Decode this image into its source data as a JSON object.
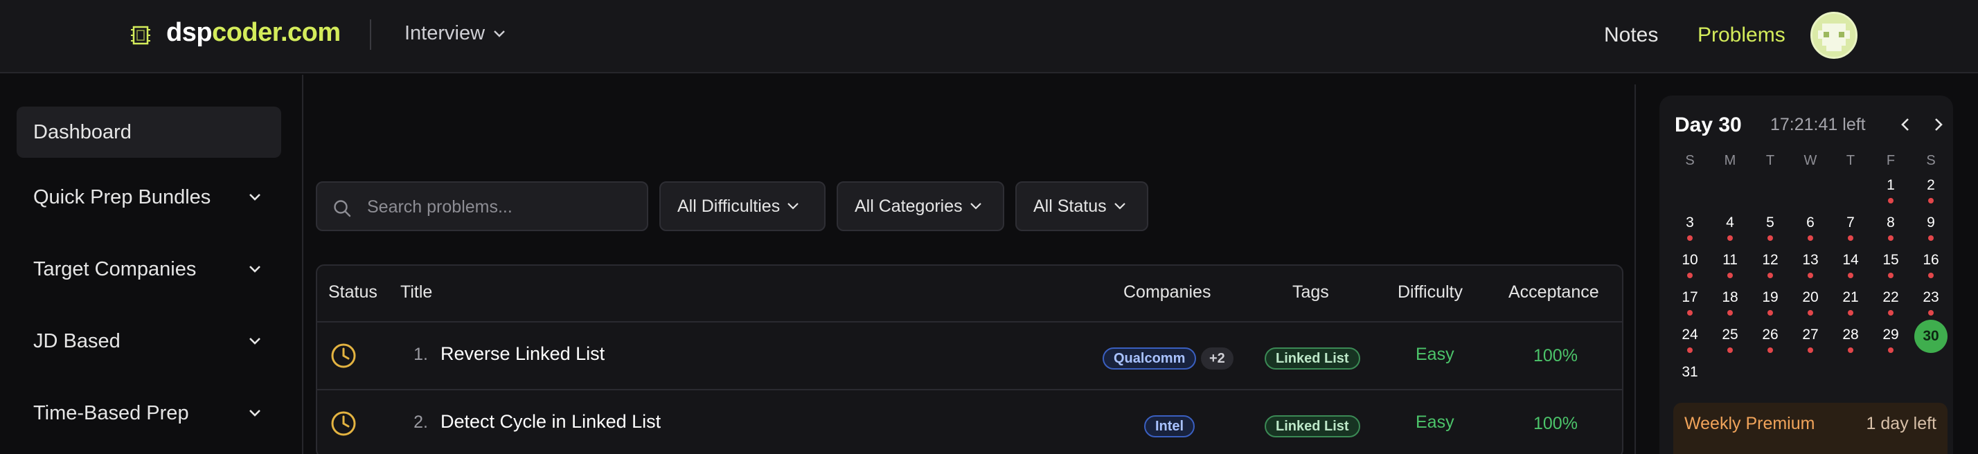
{
  "header": {
    "logo_part1": "dsp",
    "logo_part2": "coder.com",
    "interview_menu": "Interview",
    "nav_notes": "Notes",
    "nav_problems": "Problems",
    "accent_color": "#d4ec5b"
  },
  "sidebar": {
    "items": [
      {
        "label": "Dashboard",
        "active": true
      },
      {
        "label": "Quick Prep Bundles",
        "expandable": true
      },
      {
        "label": "Target Companies",
        "expandable": true
      },
      {
        "label": "JD Based",
        "expandable": true
      },
      {
        "label": "Time-Based Prep",
        "expandable": true
      }
    ]
  },
  "filters": {
    "search_placeholder": "Search problems...",
    "difficulty": "All Difficulties",
    "category": "All Categories",
    "status": "All Status"
  },
  "table": {
    "columns": [
      "Status",
      "Title",
      "Companies",
      "Tags",
      "Difficulty",
      "Acceptance"
    ],
    "rows": [
      {
        "status": "clock-icon",
        "num": "1.",
        "title": "Reverse Linked List",
        "companies": [
          "Qualcomm"
        ],
        "more": "+2",
        "tag": "Linked List",
        "difficulty": "Easy",
        "acceptance": "100%"
      },
      {
        "status": "clock-icon",
        "num": "2.",
        "title": "Detect Cycle in Linked List",
        "companies": [
          "Intel"
        ],
        "tag": "Linked List",
        "difficulty": "Easy",
        "acceptance": "100%"
      }
    ]
  },
  "calendar": {
    "day_label": "Day 30",
    "time_left": "17:21:41 left",
    "weekdays": [
      "S",
      "M",
      "T",
      "W",
      "T",
      "F",
      "S"
    ],
    "today": 30,
    "days_in_month": 31,
    "first_weekday_index": 5,
    "marked_days": [
      1,
      2,
      3,
      4,
      5,
      6,
      7,
      8,
      9,
      10,
      11,
      12,
      13,
      14,
      15,
      16,
      17,
      18,
      19,
      20,
      21,
      22,
      23,
      24,
      25,
      26,
      27,
      28,
      29
    ],
    "today_color": "#3fae4e",
    "dot_color": "#e2464a"
  },
  "premium": {
    "title": "Weekly Premium",
    "left": "1 day left"
  }
}
